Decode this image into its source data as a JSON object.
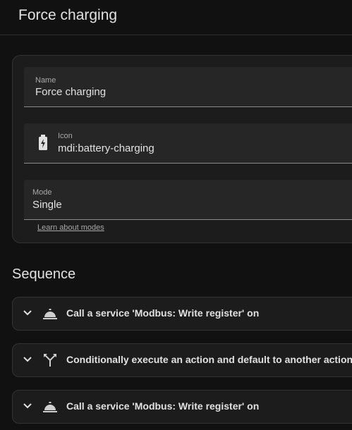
{
  "header": {
    "title": "Force charging"
  },
  "form": {
    "name_label": "Name",
    "name_value": "Force charging",
    "icon_label": "Icon",
    "icon_value": "mdi:battery-charging",
    "icon_preview": "battery-charging-icon",
    "mode_label": "Mode",
    "mode_value": "Single",
    "learn_link": "Learn about modes"
  },
  "sequence": {
    "title": "Sequence",
    "actions": [
      {
        "label": "Call a service 'Modbus: Write register' on",
        "icon": "bell-service-icon"
      },
      {
        "label": "Conditionally execute an action and default to another action",
        "icon": "call-split-icon"
      },
      {
        "label": "Call a service 'Modbus: Write register' on",
        "icon": "bell-service-icon"
      }
    ]
  },
  "colors": {
    "background": "#111111",
    "card": "#1c1c1c",
    "field": "#262626",
    "text": "#e1e1e1",
    "secondary_text": "#a8a8a8"
  }
}
